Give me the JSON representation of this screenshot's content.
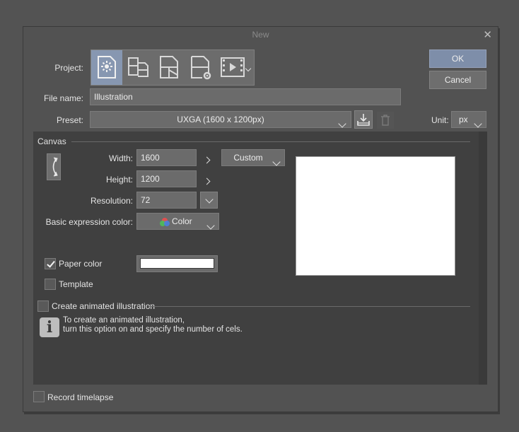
{
  "dialog": {
    "title": "New",
    "close_glyph": "✕"
  },
  "project": {
    "label": "Project:",
    "options": [
      {
        "name": "illustration",
        "icon": "illustration-icon",
        "selected": true
      },
      {
        "name": "webtoon",
        "icon": "webtoon-icon",
        "selected": false
      },
      {
        "name": "comic",
        "icon": "comic-icon",
        "selected": false
      },
      {
        "name": "comic-settings",
        "icon": "comic-settings-icon",
        "selected": false
      },
      {
        "name": "animation",
        "icon": "animation-icon",
        "selected": false
      }
    ]
  },
  "file_name": {
    "label": "File name:",
    "value": "Illustration"
  },
  "preset": {
    "label": "Preset:",
    "value": "UXGA (1600 x 1200px)"
  },
  "unit": {
    "label": "Unit:",
    "value": "px"
  },
  "buttons": {
    "ok": "OK",
    "cancel": "Cancel"
  },
  "canvas": {
    "section": "Canvas",
    "width_label": "Width:",
    "width_value": "1600",
    "height_label": "Height:",
    "height_value": "1200",
    "size_mode": "Custom",
    "resolution_label": "Resolution:",
    "resolution_value": "72",
    "color_label": "Basic expression color:",
    "color_value": "Color",
    "paper_color_label": "Paper color",
    "paper_color_checked": true,
    "paper_color_hex": "#ffffff",
    "template_label": "Template",
    "template_checked": false
  },
  "animation": {
    "label": "Create animated illustration",
    "checked": false,
    "info_line1": "To create an animated illustration,",
    "info_line2": "turn this option on and specify the number of cels."
  },
  "timelapse": {
    "label": "Record timelapse",
    "checked": false
  },
  "colors": {
    "dialog_bg": "#525252",
    "panel_bg": "#404040",
    "accent": "#8797b1"
  }
}
